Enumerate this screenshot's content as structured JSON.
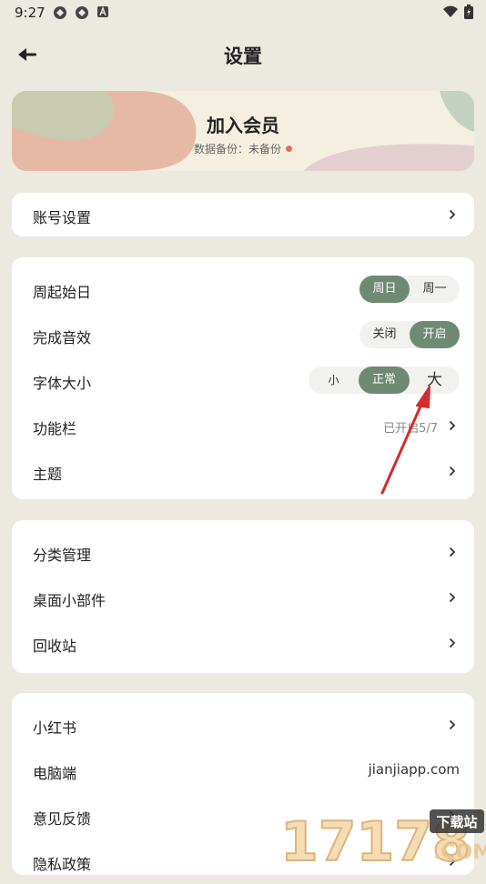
{
  "status": {
    "time": "9:27"
  },
  "header": {
    "title": "设置"
  },
  "banner": {
    "title": "加入会员",
    "subtitle": "数据备份：未备份"
  },
  "account": {
    "label": "账号设置"
  },
  "prefs": {
    "week_start": {
      "label": "周起始日",
      "options": [
        "周日",
        "周一"
      ],
      "selected": 0
    },
    "sound": {
      "label": "完成音效",
      "options": [
        "关闭",
        "开启"
      ],
      "selected": 1
    },
    "font_size": {
      "label": "字体大小",
      "options": [
        "小",
        "正常",
        "大"
      ],
      "selected": 1
    },
    "toolbar": {
      "label": "功能栏",
      "value": "已开启5/7"
    },
    "theme": {
      "label": "主题"
    }
  },
  "manage": {
    "category": {
      "label": "分类管理"
    },
    "widget": {
      "label": "桌面小部件"
    },
    "trash": {
      "label": "回收站"
    }
  },
  "more": {
    "xhs": {
      "label": "小红书"
    },
    "pc": {
      "label": "电脑端",
      "value": "jianjiapp.com"
    },
    "feedback": {
      "label": "意见反馈"
    },
    "privacy": {
      "label": "隐私政策"
    }
  },
  "watermark": {
    "text": "17178",
    "badge": "下载站",
    "domain": ".COM"
  },
  "colors": {
    "accent": "#6e8a73",
    "background": "#ece9e1",
    "dot": "#e86b5e",
    "annotation": "#d62b2b"
  }
}
